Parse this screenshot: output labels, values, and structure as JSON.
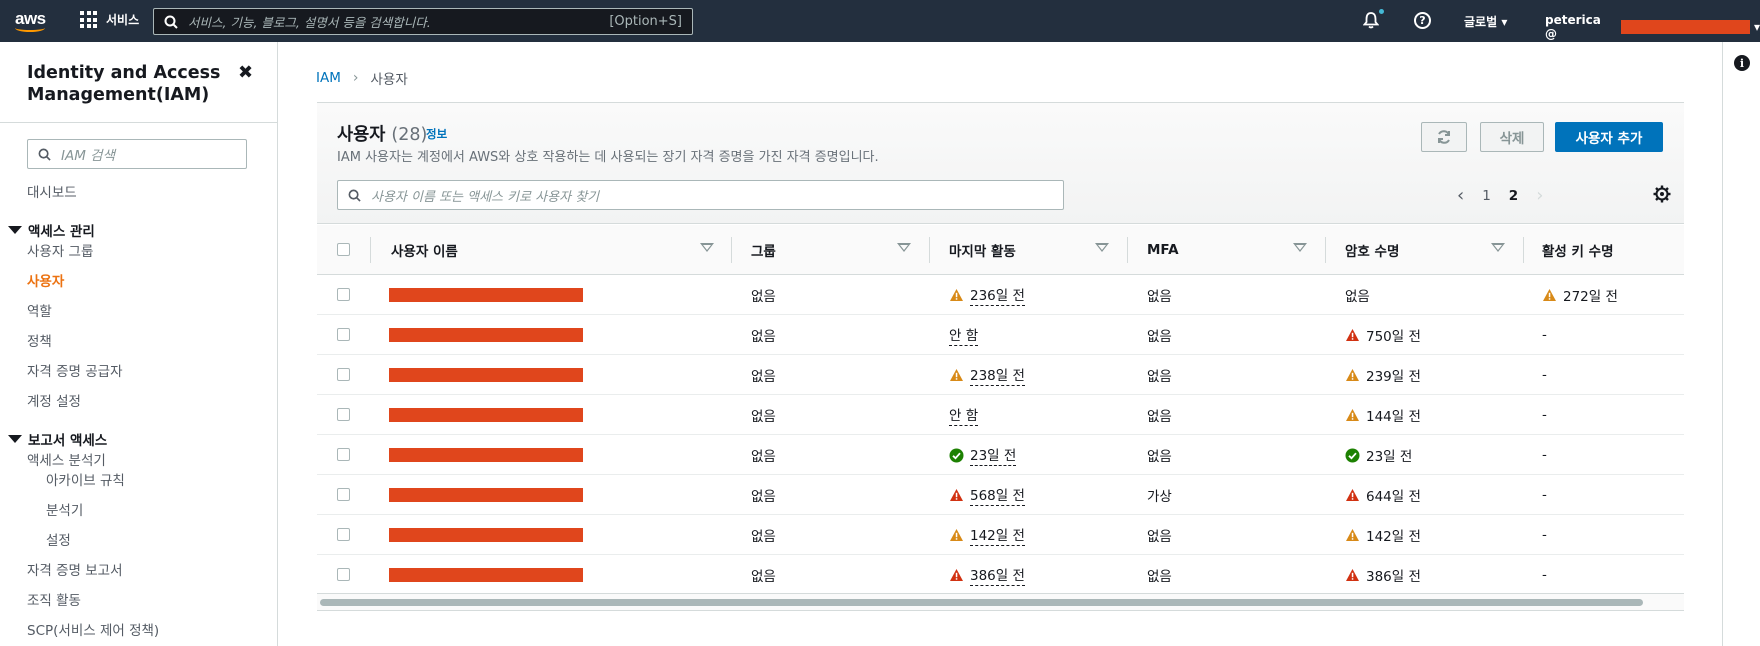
{
  "topnav": {
    "logo": "aws",
    "services_label": "서비스",
    "search_placeholder": "서비스, 기능, 블로그, 설명서 등을 검색합니다.",
    "search_shortcut": "[Option+S]",
    "region_label": "글로벌",
    "account_label": "peterica @"
  },
  "sidebar": {
    "title": "Identity and Access Management(IAM)",
    "search_placeholder": "IAM 검색",
    "dashboard": "대시보드",
    "section_access": "액세스 관리",
    "user_groups": "사용자 그룹",
    "users": "사용자",
    "roles": "역할",
    "policies": "정책",
    "identity_providers": "자격 증명 공급자",
    "account_settings": "계정 설정",
    "section_reports": "보고서 액세스",
    "access_analyzer": "액세스 분석기",
    "archive_rules": "아카이브 규칙",
    "analyzers": "분석기",
    "settings": "설정",
    "credential_report": "자격 증명 보고서",
    "org_activity": "조직 활동",
    "scp": "SCP(서비스 제어 정책)"
  },
  "breadcrumb": {
    "root": "IAM",
    "current": "사용자"
  },
  "panel": {
    "title": "사용자",
    "count": "(28)",
    "info_link": "정보",
    "description": "IAM 사용자는 계정에서 AWS와 상호 작용하는 데 사용되는 장기 자격 증명을 가진 자격 증명입니다.",
    "delete_button": "삭제",
    "add_button": "사용자 추가",
    "search_placeholder": "사용자 이름 또는 액세스 키로 사용자 찾기",
    "page_1": "1",
    "page_2": "2"
  },
  "table": {
    "headers": {
      "username": "사용자 이름",
      "groups": "그룹",
      "last_activity": "마지막 활동",
      "mfa": "MFA",
      "password_age": "암호 수명",
      "active_key_age": "활성 키 수명"
    },
    "rows": [
      {
        "groups": "없음",
        "last_activity": "236일 전",
        "last_status": "warning",
        "mfa": "없음",
        "password_age": "없음",
        "password_status": "none",
        "key_age": "272일 전",
        "key_status": "warning"
      },
      {
        "groups": "없음",
        "last_activity": "안 함",
        "last_status": "none",
        "mfa": "없음",
        "password_age": "750일 전",
        "password_status": "error",
        "key_age": "-",
        "key_status": "none"
      },
      {
        "groups": "없음",
        "last_activity": "238일 전",
        "last_status": "warning",
        "mfa": "없음",
        "password_age": "239일 전",
        "password_status": "warning",
        "key_age": "-",
        "key_status": "none"
      },
      {
        "groups": "없음",
        "last_activity": "안 함",
        "last_status": "none",
        "mfa": "없음",
        "password_age": "144일 전",
        "password_status": "warning",
        "key_age": "-",
        "key_status": "none"
      },
      {
        "groups": "없음",
        "last_activity": "23일 전",
        "last_status": "success",
        "mfa": "없음",
        "password_age": "23일 전",
        "password_status": "success",
        "key_age": "-",
        "key_status": "none"
      },
      {
        "groups": "없음",
        "last_activity": "568일 전",
        "last_status": "error",
        "mfa": "가상",
        "password_age": "644일 전",
        "password_status": "error",
        "key_age": "-",
        "key_status": "none"
      },
      {
        "groups": "없음",
        "last_activity": "142일 전",
        "last_status": "warning",
        "mfa": "없음",
        "password_age": "142일 전",
        "password_status": "warning",
        "key_age": "-",
        "key_status": "none"
      },
      {
        "groups": "없음",
        "last_activity": "386일 전",
        "last_status": "error",
        "mfa": "없음",
        "password_age": "386일 전",
        "password_status": "error",
        "key_age": "-",
        "key_status": "none"
      }
    ]
  },
  "colors": {
    "nav_bg": "#232f3e",
    "accent_orange": "#ec7211",
    "link_blue": "#0073bb",
    "warning": "#d88a18",
    "error": "#d13212",
    "success": "#1d8102",
    "redaction": "#e0461c"
  }
}
